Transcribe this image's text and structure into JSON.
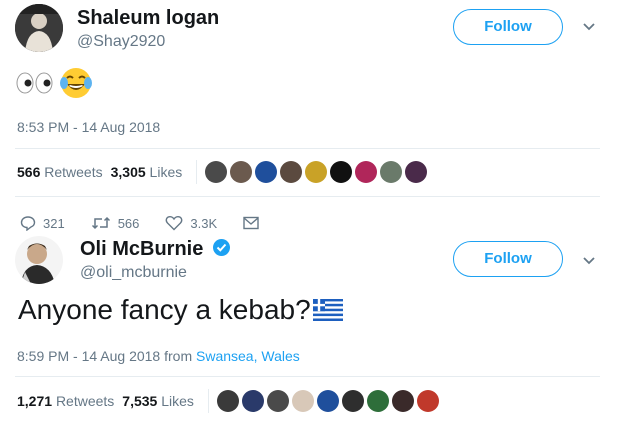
{
  "tweet1": {
    "display_name": "Shaleum logan",
    "screen_name": "@Shay2920",
    "follow_label": "Follow",
    "emoji_text": "👀😂",
    "timestamp": "8:53 PM - 14 Aug 2018",
    "retweets": "566",
    "retweets_label": "Retweets",
    "likes": "3,305",
    "likes_label": "Likes",
    "liker_colors": [
      "#4a4a4a",
      "#6b5a4e",
      "#1f4f9c",
      "#5b4a3f",
      "#c9a227",
      "#111111",
      "#b0265a",
      "#6a7a6a",
      "#4a2a4a"
    ],
    "actions": {
      "replies": "321",
      "retweets": "566",
      "likes": "3.3K"
    }
  },
  "tweet2": {
    "display_name": "Oli McBurnie",
    "screen_name": "@oli_mcburnie",
    "follow_label": "Follow",
    "text": "Anyone fancy a kebab?",
    "timestamp": "8:59 PM - 14 Aug 2018 from ",
    "location": "Swansea, Wales",
    "retweets": "1,271",
    "retweets_label": "Retweets",
    "likes": "7,535",
    "likes_label": "Likes",
    "liker_colors": [
      "#3a3a3a",
      "#2a3a6a",
      "#4a4a4a",
      "#d8c8b8",
      "#1f4f9c",
      "#2e2e2e",
      "#2e6e3a",
      "#3a2a2a",
      "#c0392b"
    ]
  },
  "colors": {
    "accent": "#1da1f2",
    "muted": "#657786",
    "text": "#14171a"
  }
}
